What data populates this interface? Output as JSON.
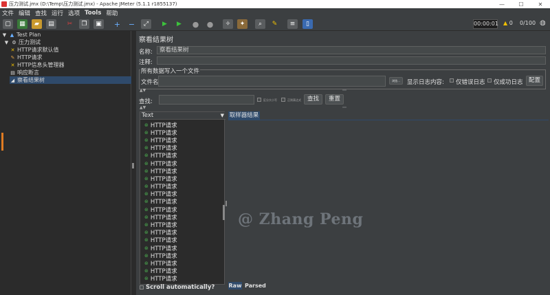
{
  "window": {
    "title": "压力测试.jmx (D:\\Temp\\压力测试.jmx) - Apache JMeter (5.1.1 r1855137)",
    "minimize": "—",
    "maximize": "☐",
    "close": "✕"
  },
  "menu": [
    "文件",
    "编辑",
    "查找",
    "运行",
    "选项",
    "Tools",
    "帮助"
  ],
  "toolbar": {
    "timer": "00:00:01",
    "warnings": "0",
    "threads": "0/100"
  },
  "tree": {
    "items": [
      {
        "label": "Test Plan",
        "icon": "test-plan-icon"
      },
      {
        "label": "压力测试",
        "icon": "thread-group-icon"
      },
      {
        "label": "HTTP请求默认值",
        "icon": "config-icon"
      },
      {
        "label": "HTTP请求",
        "icon": "sampler-icon"
      },
      {
        "label": "HTTP信息头管理器",
        "icon": "config-icon"
      },
      {
        "label": "响应断言",
        "icon": "assertion-icon"
      },
      {
        "label": "察看结果树",
        "icon": "listener-icon"
      }
    ]
  },
  "panel": {
    "title": "察看结果树",
    "name_label": "名称:",
    "name_value": "察看结果树",
    "comment_label": "注释:",
    "comment_value": "",
    "group_title": "所有数据写入一个文件",
    "filename_label": "文件名",
    "filename_value": "",
    "browse_label": "浏览...",
    "log_display_label": "显示日志内容:",
    "errors_only_label": "仅错误日志",
    "success_only_label": "仅成功日志",
    "configure_label": "配置",
    "search_label": "查找:",
    "search_value": "",
    "case_sensitive_label": "区分大小写",
    "regex_label": "正则表达式",
    "find_button": "查找",
    "reset_button": "重置"
  },
  "results": {
    "column_header": "Text",
    "items": [
      "HTTP请求",
      "HTTP请求",
      "HTTP请求",
      "HTTP请求",
      "HTTP请求",
      "HTTP请求",
      "HTTP请求",
      "HTTP请求",
      "HTTP请求",
      "HTTP请求",
      "HTTP请求",
      "HTTP请求",
      "HTTP请求",
      "HTTP请求",
      "HTTP请求",
      "HTTP请求",
      "HTTP请求",
      "HTTP请求",
      "HTTP请求",
      "HTTP请求",
      "HTTP请求"
    ],
    "scroll_auto_label": "Scroll automatically?",
    "sampler_tab": "取样器结果",
    "tab_raw": "Raw",
    "tab_parsed": "Parsed"
  },
  "watermark": "@ Zhang Peng",
  "colors": {
    "background": "#3c3f41",
    "selected": "#2f4a6b",
    "success": "#4caf50",
    "warning": "#f0c000"
  }
}
